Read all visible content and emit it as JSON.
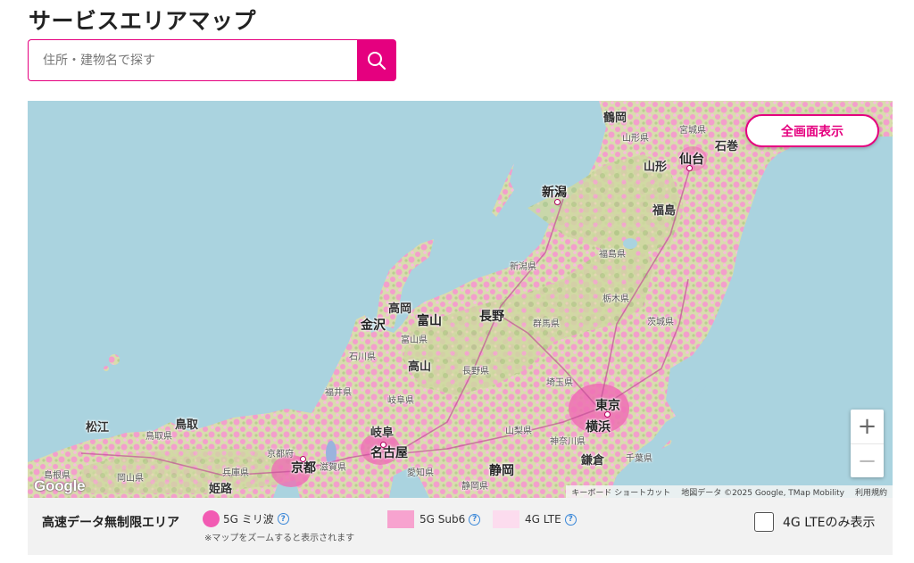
{
  "page": {
    "title": "サービスエリアマップ"
  },
  "search": {
    "placeholder": "住所・建物名で探す"
  },
  "map": {
    "fullscreen_label": "全画面表示",
    "zoom_in": "+",
    "zoom_out": "−",
    "google_logo": "Google",
    "attribution": {
      "shortcuts": "キーボード ショートカット",
      "data": "地図データ ©2025 Google, TMap Mobility",
      "terms": "利用規約"
    },
    "labels": {
      "tsuruoka": "鶴岡",
      "miyagi": "宮城県",
      "yamagata_pref": "山形県",
      "ishinomaki": "石巻",
      "yamagata": "山形",
      "sendai": "仙台",
      "niigata": "新潟",
      "fukushima": "福島",
      "niigata_pref": "新潟県",
      "fukushima_pref": "福島県",
      "tochigi_pref": "栃木県",
      "takaoka": "高岡",
      "toyama": "富山",
      "kanazawa": "金沢",
      "nagano": "長野",
      "gunma_pref": "群馬県",
      "ibaraki_pref": "茨城県",
      "toyama_pref": "富山県",
      "ishikawa_pref": "石川県",
      "takayama": "高山",
      "nagano_pref": "長野県",
      "saitama_pref": "埼玉県",
      "fukui_pref": "福井県",
      "gifu_pref": "岐阜県",
      "tokyo": "東京",
      "matsue": "松江",
      "tottori": "鳥取",
      "tottori_pref": "鳥取県",
      "gifu": "岐阜",
      "yamanashi_pref": "山梨県",
      "yokohama": "横浜",
      "kanagawa_pref": "神奈川県",
      "kyoto_pref": "京都府",
      "shiga_pref": "滋賀県",
      "kyoto": "京都",
      "nagoya": "名古屋",
      "kamakura": "鎌倉",
      "chiba_pref": "千葉県",
      "shimane_pref": "島根県",
      "okayama_pref": "岡山県",
      "hyogo_pref": "兵庫県",
      "aichi_pref": "愛知県",
      "shizuoka": "静岡",
      "himeji": "姫路",
      "shizuoka_pref": "静岡県"
    }
  },
  "legend": {
    "title": "高速データ無制限エリア",
    "items": [
      {
        "label": "5G ミリ波",
        "color": "#f25bb3"
      },
      {
        "label": "5G Sub6",
        "color": "#f7a3cf"
      },
      {
        "label": "4G LTE",
        "color": "#fcdcee"
      }
    ],
    "note": "※マップをズームすると表示されます",
    "lte_only_label": "4G LTEのみ表示",
    "lte_only_checked": false
  }
}
